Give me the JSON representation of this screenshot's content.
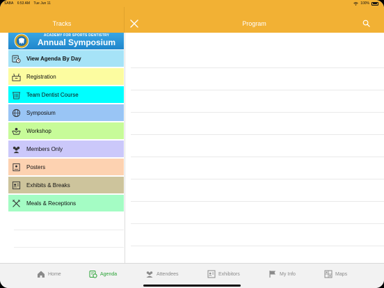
{
  "status_bar": {
    "carrier": "SABA",
    "time": "6:53 AM",
    "date": "Tue Jun 11",
    "battery": "100%"
  },
  "header": {
    "left_title": "Tracks",
    "right_title": "Program"
  },
  "logo": {
    "small_text": "ACADEMY FOR SPORTS DENTISTRY",
    "big_text": "Annual Symposium"
  },
  "tracks": [
    {
      "label": "View Agenda By Day",
      "color": "#a6e3f7",
      "icon": "calendar-clock-icon"
    },
    {
      "label": "Registration",
      "color": "#fcfca0",
      "icon": "registration-desk-icon"
    },
    {
      "label": "Team Dentist Course",
      "color": "#00ffff",
      "icon": "podium-icon"
    },
    {
      "label": "Symposium",
      "color": "#99c5f5",
      "icon": "globe-icon"
    },
    {
      "label": "Workshop",
      "color": "#c7fb99",
      "icon": "workshop-hands-icon"
    },
    {
      "label": "Members Only",
      "color": "#cbc8fa",
      "icon": "group-icon"
    },
    {
      "label": "Posters",
      "color": "#fdd2b1",
      "icon": "poster-icon"
    },
    {
      "label": "Exhibits & Breaks",
      "color": "#cdc49c",
      "icon": "exhibit-badge-icon"
    },
    {
      "label": "Meals & Receptions",
      "color": "#a4fcc4",
      "icon": "fork-knife-icon"
    }
  ],
  "tabs": [
    {
      "label": "Home",
      "icon": "home-icon",
      "active": false
    },
    {
      "label": "Agenda",
      "icon": "agenda-icon",
      "active": true
    },
    {
      "label": "Attendees",
      "icon": "attendees-icon",
      "active": false
    },
    {
      "label": "Exhibitors",
      "icon": "exhibitors-icon",
      "active": false
    },
    {
      "label": "My Info",
      "icon": "flag-icon",
      "active": false
    },
    {
      "label": "Maps",
      "icon": "map-icon",
      "active": false
    }
  ],
  "colors": {
    "header": "#f2b134",
    "active_tab": "#2aa336",
    "inactive_tab": "#8a8a8a"
  }
}
